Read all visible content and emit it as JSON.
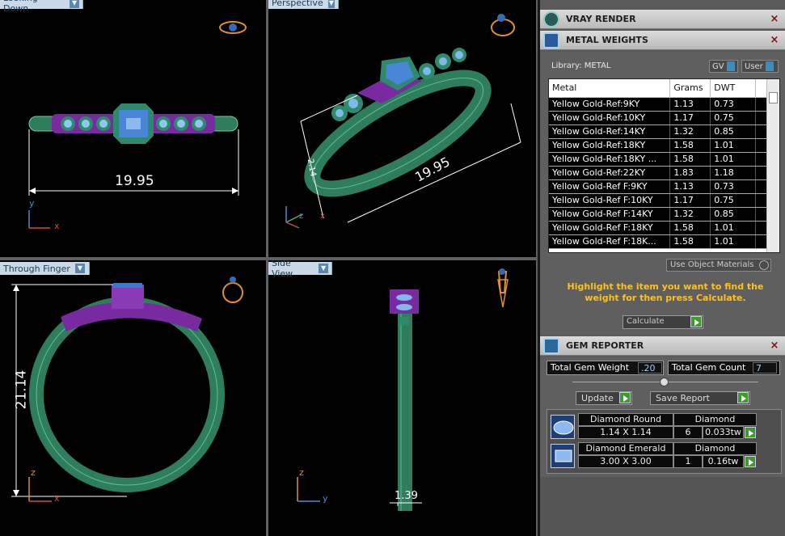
{
  "viewports": {
    "top_left": {
      "label": "Looking Down",
      "dimension": "19.95",
      "axis_y": "y",
      "axis_x": "x"
    },
    "top_right": {
      "label": "Perspective",
      "dimension_a": "19.95",
      "dimension_b": "2.14",
      "axis_z": "z",
      "axis_y": "y",
      "axis_x": "x"
    },
    "bottom_left": {
      "label": "Through Finger",
      "dimension": "21.14",
      "axis_z": "z",
      "axis_x": "x"
    },
    "bottom_right": {
      "label": "Side View",
      "dimension": "1.39",
      "axis_z": "z",
      "axis_y": "y"
    }
  },
  "vray": {
    "title": "VRAY RENDER",
    "close": "×"
  },
  "metal_weights": {
    "title": "METAL WEIGHTS",
    "close": "×",
    "library_label": "Library: METAL",
    "gv_label": "GV",
    "user_label": "User",
    "columns": [
      "Metal",
      "Grams",
      "DWT"
    ],
    "rows": [
      [
        "Yellow Gold-Ref:9KY",
        "1.13",
        "0.73"
      ],
      [
        "Yellow Gold-Ref:10KY",
        "1.17",
        "0.75"
      ],
      [
        "Yellow Gold-Ref:14KY",
        "1.32",
        "0.85"
      ],
      [
        "Yellow Gold-Ref:18KY",
        "1.58",
        "1.01"
      ],
      [
        "Yellow Gold-Ref:18KY ...",
        "1.58",
        "1.01"
      ],
      [
        "Yellow Gold-Ref:22KY",
        "1.83",
        "1.18"
      ],
      [
        "Yellow Gold-Ref F:9KY",
        "1.13",
        "0.73"
      ],
      [
        "Yellow Gold-Ref F:10KY",
        "1.17",
        "0.75"
      ],
      [
        "Yellow Gold-Ref F:14KY",
        "1.32",
        "0.85"
      ],
      [
        "Yellow Gold-Ref F:18KY",
        "1.58",
        "1.01"
      ],
      [
        "Yellow Gold-Ref F:18K...",
        "1.58",
        "1.01"
      ]
    ],
    "use_object_materials": "Use Object Materials",
    "hint": "Highlight the item you want to find the weight for then press Calculate.",
    "calculate_label": "Calculate"
  },
  "gem_reporter": {
    "title": "GEM REPORTER",
    "close": "×",
    "total_weight_label": "Total Gem Weight",
    "total_weight_value": ".20",
    "total_count_label": "Total Gem Count",
    "total_count_value": "7",
    "update_label": "Update",
    "save_report_label": "Save Report",
    "gems": [
      {
        "shape": "Diamond Round",
        "size": "1.14 X 1.14",
        "type": "Diamond",
        "count": "6",
        "weight": "0.033tw"
      },
      {
        "shape": "Diamond Emerald",
        "size": "3.00 X 3.00",
        "type": "Diamond",
        "count": "1",
        "weight": "0.16tw"
      }
    ]
  },
  "colors": {
    "ring_green": "#2e7d5c",
    "ring_purple": "#7a2aa0",
    "gem_blue": "#3a78c8",
    "accent_yellow": "#ffc21a"
  }
}
